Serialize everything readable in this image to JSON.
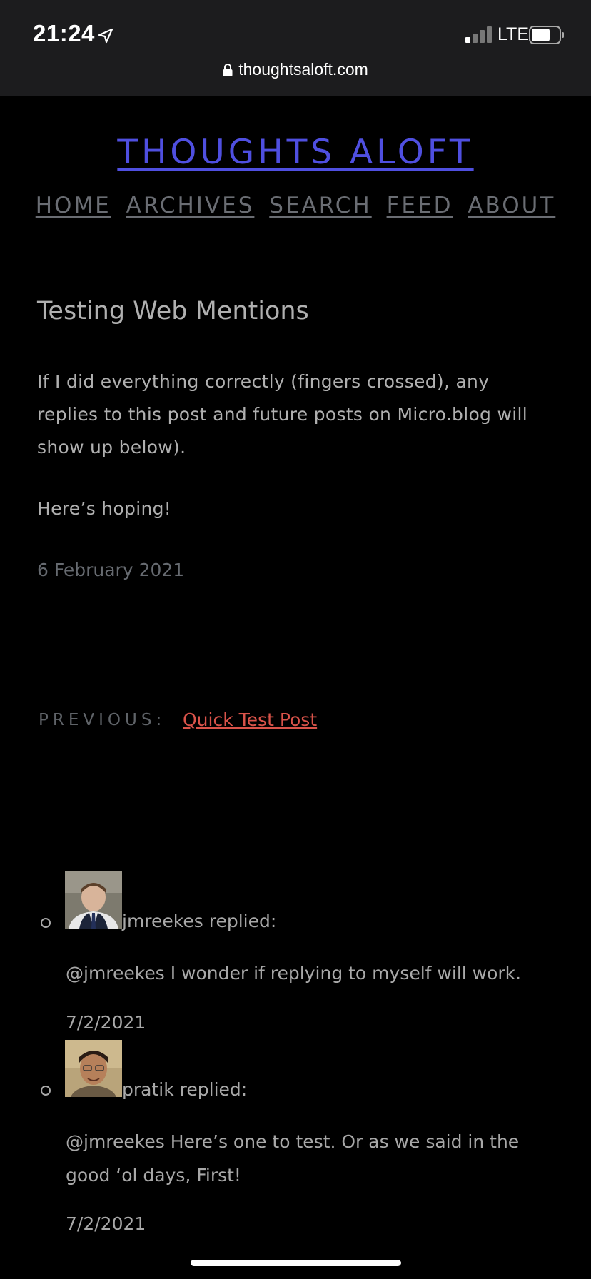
{
  "status_bar": {
    "time": "21:24",
    "network": "LTE",
    "url": "thoughtsaloft.com"
  },
  "site": {
    "title": "THOUGHTS ALOFT",
    "title_color": "#4f4fe0",
    "nav": [
      "HOME",
      "ARCHIVES",
      "SEARCH",
      "FEED",
      "ABOUT"
    ]
  },
  "post": {
    "title": "Testing Web Mentions",
    "paragraphs": [
      "If I did everything correctly (fingers crossed), any replies to this post and future posts on Micro.blog will show up below).",
      "Here’s hoping!"
    ],
    "date": "6 February 2021"
  },
  "pagination": {
    "previous_label": "PREVIOUS:",
    "previous_link": "Quick Test Post",
    "link_color": "#d9534a"
  },
  "replies": [
    {
      "author_line": "jmreekes replied:",
      "text": "@jmreekes I wonder if replying to myself will work.",
      "date": "7/2/2021"
    },
    {
      "author_line": "pratik replied:",
      "text": "@jmreekes Here’s one to test. Or as we said in the good ‘ol days, First!",
      "date": "7/2/2021"
    }
  ]
}
